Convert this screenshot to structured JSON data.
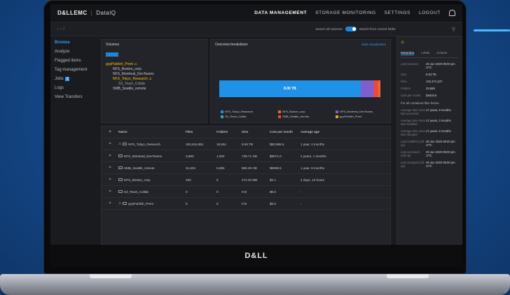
{
  "app": {
    "brand": "D&LLEMC",
    "product": "DataIQ"
  },
  "nav": {
    "items": [
      "DATA MANAGEMENT",
      "STORAGE MONITORING",
      "SETTINGS",
      "LOGOUT"
    ]
  },
  "searchbar": {
    "crumbs": "‹ ↑ /",
    "toggle_label_1": "Search all volumes",
    "toggle_label_2": "Search from current folder"
  },
  "sidebar": {
    "items": [
      "Browse",
      "Analyze",
      "Flagged items",
      "Tag management",
      "Jobs",
      "Logs",
      "View Transfers"
    ],
    "jobs_badge": "1"
  },
  "volumes_panel": {
    "title": "Volumes",
    "tree": [
      {
        "label": "gcpPublish_Prem ⚠",
        "level": 0,
        "warn": true
      },
      {
        "label": "NFS_Boston_corp",
        "level": 1
      },
      {
        "label": "NFS_Montreal_DevTeams",
        "level": 1
      },
      {
        "label": "NFS_Tokyo_Research ⚠",
        "level": 1,
        "warn": true
      },
      {
        "label": "S3_Team_Collab",
        "level": 2
      },
      {
        "label": "SMB_Seattle_remote",
        "level": 1
      }
    ]
  },
  "chart_panel": {
    "title": "Overview breakdown",
    "link": "Hide visualization",
    "bar_label": "8.00 TB",
    "legend": [
      {
        "name": "NFS_Tokyo_Research",
        "color": "#1f91e6"
      },
      {
        "name": "NFS_Boston_corp",
        "color": "#f06a2b"
      },
      {
        "name": "NFS_Montreal_DevTeams",
        "color": "#7f5fd0"
      },
      {
        "name": "S3_Team_Collab",
        "color": "#3aa6a0"
      },
      {
        "name": "SMB_Seattle_remote",
        "color": "#e84a3f"
      },
      {
        "name": "gcpPublish_Prem",
        "color": "#f0a12b"
      }
    ]
  },
  "chart_data": {
    "type": "bar",
    "categories": [
      "NFS_Tokyo_Research",
      "NFS_Montreal_DevTeams",
      "SMB_Seattle_remote",
      "NFS_Boston_corp",
      "S3_Team_Collab",
      "gcpPublish_Prem"
    ],
    "values": [
      7.91,
      0.7,
      0.3,
      0.0004,
      0,
      0
    ],
    "title": "Overview breakdown",
    "xlabel": "",
    "ylabel": ""
  },
  "table": {
    "headers": [
      "Name",
      "Files",
      "Folders",
      "Size",
      "Cost per month",
      "Average age"
    ],
    "rows": [
      {
        "name": "NFS_Tokyo_Research",
        "warn": true,
        "files": "100,616,981",
        "folders": "18,551",
        "size": "8.93 TB",
        "cost": "$83,986.5",
        "age": "1 year, 2 months"
      },
      {
        "name": "NFS_Montreal_DevTeams",
        "warn": false,
        "files": "3,860",
        "folders": "1,002",
        "size": "728.71 GB",
        "cost": "$8071.0",
        "age": "2 years, 1 months"
      },
      {
        "name": "SMB_Seattle_remote",
        "warn": false,
        "files": "31,604",
        "folders": "5,895",
        "size": "595.25 GB",
        "cost": "$5598.5",
        "age": "1 year, 8 months"
      },
      {
        "name": "NFS_Boston_corp",
        "warn": false,
        "files": "230",
        "folders": "5",
        "size": "474.63 MB",
        "cost": "$2.1",
        "age": "4 days, 13 hours"
      },
      {
        "name": "S3_Team_Collab",
        "warn": false,
        "files": "0",
        "folders": "0",
        "size": "0 B",
        "cost": "$0.0",
        "age": "-"
      },
      {
        "name": "gcpPublish_Prem",
        "warn": true,
        "files": "0",
        "folders": "0",
        "size": "0 B",
        "cost": "$0.0",
        "age": "-"
      }
    ]
  },
  "right_panel": {
    "tabs": [
      "Metadata",
      "Limits",
      "Actions"
    ],
    "kv": [
      {
        "k": "Last scanned",
        "v": "29 Jun 2020 09:00 pm UTC"
      },
      {
        "k": "Size",
        "v": "8.93 TB"
      },
      {
        "k": "Files",
        "v": "102,471,637"
      },
      {
        "k": "Folders",
        "v": "29,586"
      },
      {
        "k": "Cost per month",
        "v": "$4918.6"
      }
    ],
    "sub_title": "For all contained files below:",
    "kv2": [
      {
        "k": "Average time since last accessed",
        "v": "17 years, 9 months"
      },
      {
        "k": "Average time since last modified",
        "v": "17 years, 3 months"
      },
      {
        "k": "Average time since last changed",
        "v": "17 years, 6 months"
      },
      {
        "k": "Last modified (roll-up)",
        "v": "29 Jun 2020 09:00 pm UTC"
      },
      {
        "k": "Last accessed (roll-up)",
        "v": "29 Jun 2020 09:00 pm UTC"
      },
      {
        "k": "Last changed (roll-up)",
        "v": "29 Jun 2020 09:00 pm UTC"
      }
    ]
  },
  "bezel": {
    "logo": "D&LL"
  }
}
